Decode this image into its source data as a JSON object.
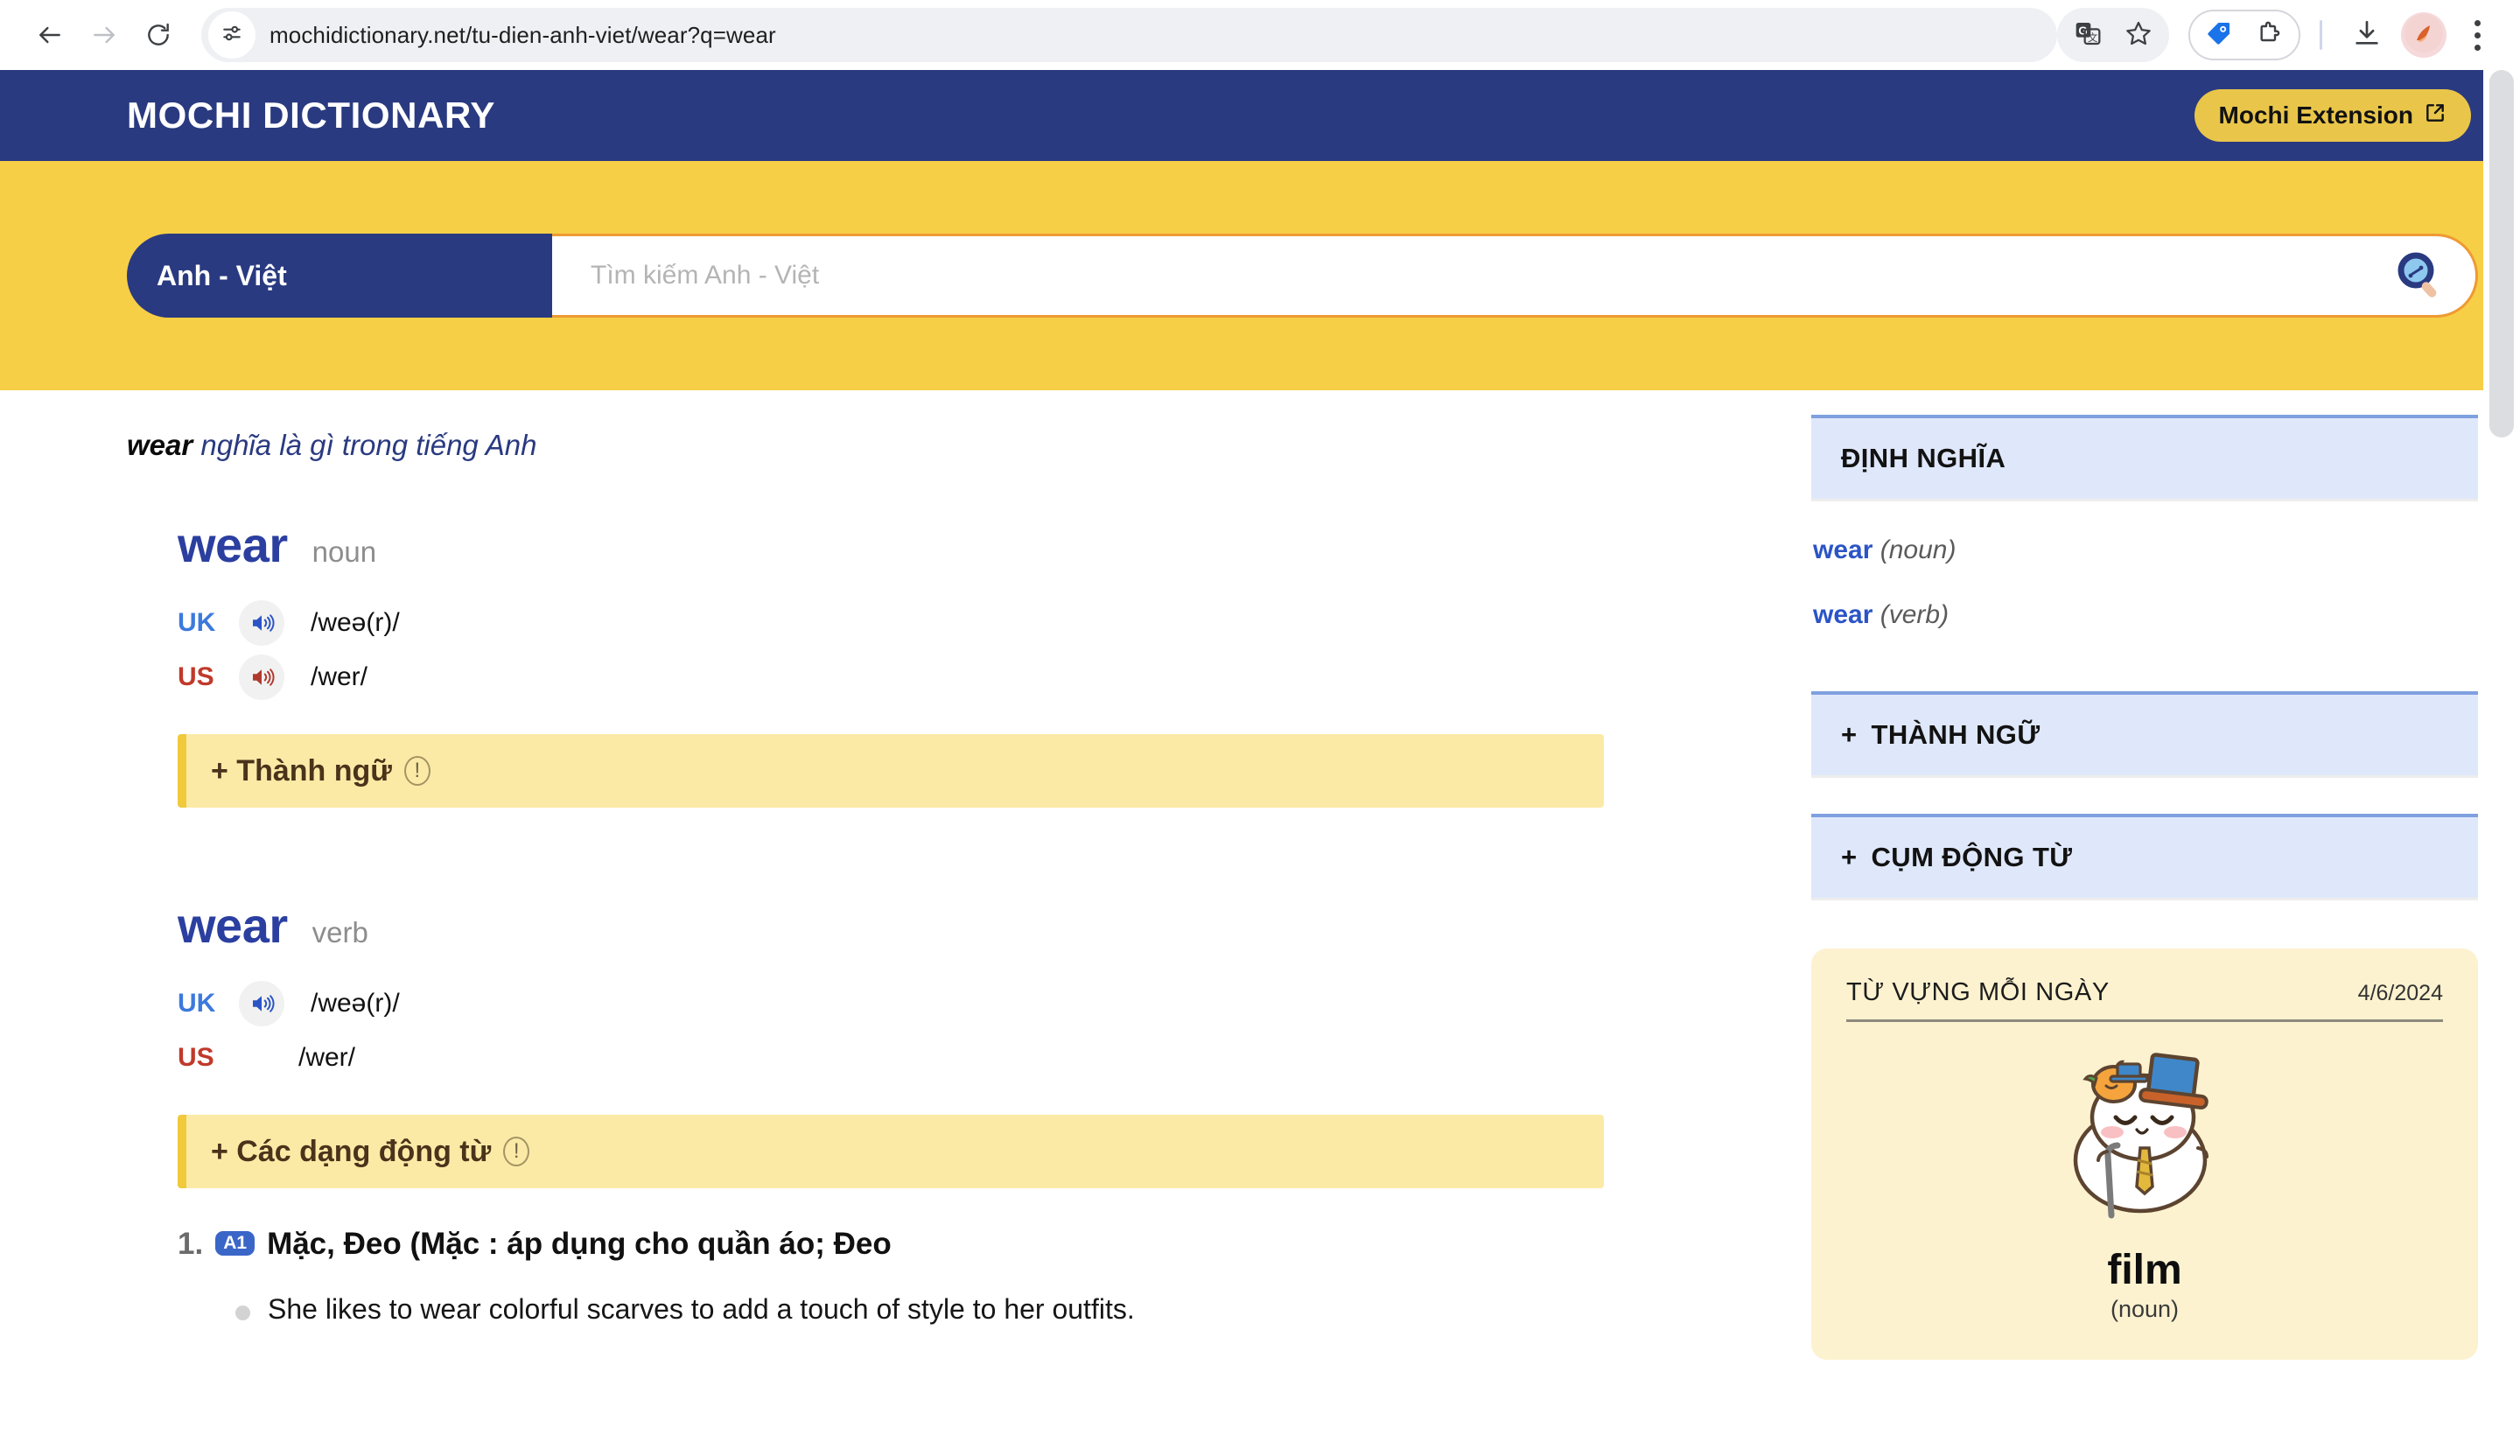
{
  "browser": {
    "url": "mochidictionary.net/tu-dien-anh-viet/wear?q=wear",
    "icons": {
      "back": "back-arrow-icon",
      "forward": "forward-arrow-icon",
      "reload": "reload-icon",
      "site_info": "site-settings-icon",
      "translate": "google-translate-icon",
      "bookmark": "star-icon",
      "price_tag": "price-tracking-icon",
      "extensions": "extensions-puzzle-icon",
      "downloads": "download-icon",
      "profile": "profile-avatar-icon",
      "menu": "three-dot-menu-icon"
    }
  },
  "header": {
    "brand": "MOCHI DICTIONARY",
    "extension_button": "Mochi Extension"
  },
  "search": {
    "language_pair": "Anh - Việt",
    "placeholder": "Tìm kiếm Anh - Việt",
    "value": ""
  },
  "main": {
    "page_title_word": "wear",
    "page_title_rest": " nghĩa là gì trong tiếng Anh",
    "entries": [
      {
        "headword": "wear",
        "pos": "noun",
        "pron": [
          {
            "region": "UK",
            "ipa": "/weə(r)/",
            "has_speaker": true
          },
          {
            "region": "US",
            "ipa": "/wer/",
            "has_speaker": true
          }
        ],
        "banner": "+ Thành ngữ",
        "senses": []
      },
      {
        "headword": "wear",
        "pos": "verb",
        "pron": [
          {
            "region": "UK",
            "ipa": "/weə(r)/",
            "has_speaker": true
          },
          {
            "region": "US",
            "ipa": "/wer/",
            "has_speaker": false
          }
        ],
        "banner": "+ Các dạng động từ",
        "senses": [
          {
            "number": "1.",
            "level": "A1",
            "text": "Mặc, Đeo (Mặc : áp dụng cho quần áo; Đeo",
            "example": "She likes to wear colorful scarves to add a touch of style to her outfits."
          }
        ]
      }
    ]
  },
  "sidebar": {
    "definition_panel": {
      "title": "ĐỊNH NGHĨA",
      "links": [
        {
          "word": "wear",
          "pos": "(noun)"
        },
        {
          "word": "wear",
          "pos": "(verb)"
        }
      ]
    },
    "collapsibles": [
      {
        "label": "THÀNH NGỮ",
        "prefix": "+"
      },
      {
        "label": "CỤM ĐỘNG TỪ",
        "prefix": "+"
      }
    ],
    "daily": {
      "title": "TỪ VỰNG MỖI NGÀY",
      "date": "4/6/2024",
      "word": "film",
      "pos": "(noun)",
      "mascot": "mochi-mascot-illustration"
    }
  },
  "colors": {
    "navy": "#2a3a80",
    "yellow": "#f7cf46",
    "accent_blue": "#2b54c6",
    "banner_yellow": "#fbeaa6",
    "panel_blue": "#dfe8fa",
    "card_cream": "#fcf2cf"
  }
}
